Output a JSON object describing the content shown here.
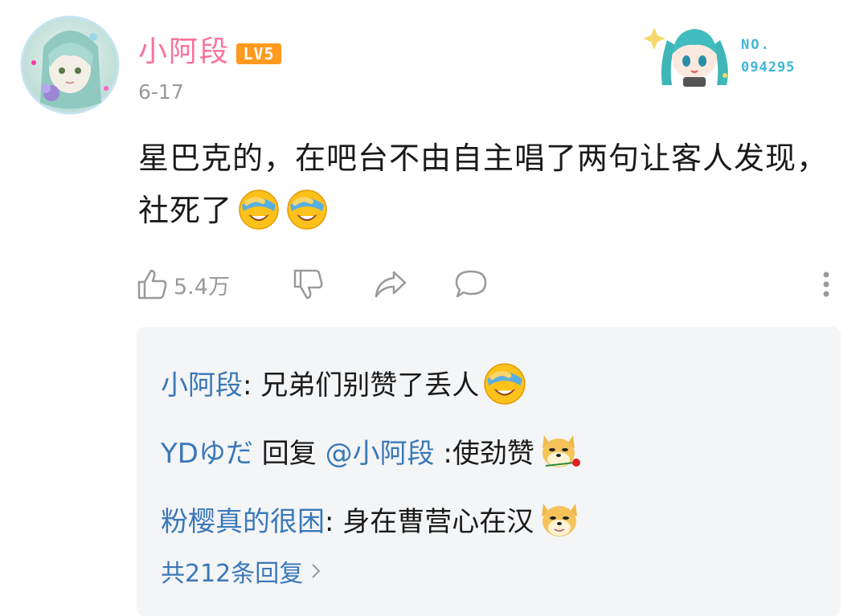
{
  "comment": {
    "username": "小阿段",
    "level": "LV5",
    "date": "6-17",
    "text": "星巴克的，在吧台不由自主唱了两句让客人发现，社死了",
    "like_count": "5.4万",
    "emojis": [
      "facepalm-laugh-emoji",
      "facepalm-laugh-emoji"
    ]
  },
  "badge": {
    "label": "NO.",
    "number": "094295"
  },
  "replies": [
    {
      "name": "小阿段",
      "sep": ": ",
      "text": "兄弟们别赞了丢人",
      "emoji": "facepalm-laugh-emoji"
    },
    {
      "name": "YDゆだ",
      "reply_word": " 回复 ",
      "mention": "@小阿段",
      "sep": " :",
      "text": "使劲赞",
      "emoji": "doge-rose-emoji"
    },
    {
      "name": "粉樱真的很困",
      "sep": ": ",
      "text": "身在曹营心在汉",
      "emoji": "doge-emoji"
    }
  ],
  "replies_footer": "共212条回复",
  "colors": {
    "username": "#fb7299",
    "level_bg": "#ff9a1e",
    "link": "#3a78b8",
    "muted": "#999999",
    "reply_bg": "#f4f5f7"
  }
}
